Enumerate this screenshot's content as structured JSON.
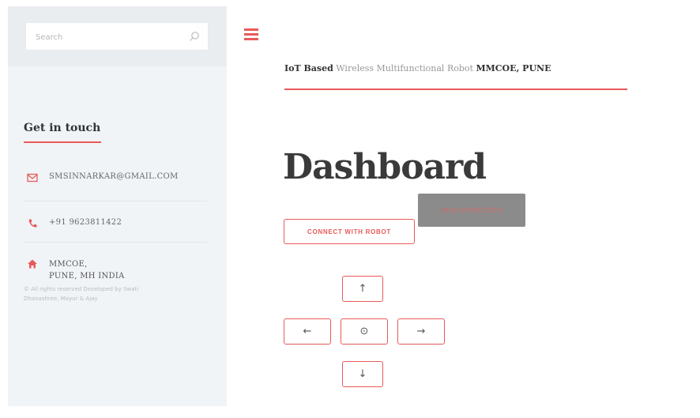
{
  "sidebar": {
    "search": {
      "placeholder": "Search"
    },
    "contact": {
      "title": "Get in touch",
      "email": "SMSINNARKAR@GMAIL.COM",
      "phone": "+91 9623811422",
      "address_line1": "MMCOE,",
      "address_line2": "PUNE, MH INDIA",
      "copyright_line1": "© All rights reserved Developed by Swati",
      "copyright_line2": "Dhanashree, Mayur & Ajay"
    }
  },
  "header": {
    "subtitle_bold1": "IoT Based",
    "subtitle_middle": " Wireless Multifunctional Robot ",
    "subtitle_bold2": "MMCOE, PUNE"
  },
  "main": {
    "title": "Dashboard",
    "connect_label": "CONNECT WITH ROBOT",
    "status_label": "DISCONNECTED",
    "controls": {
      "up": "↑",
      "left": "←",
      "stop": "⊙",
      "right": "→",
      "down": "↓"
    }
  },
  "colors": {
    "accent": "#e85a5a",
    "sidebar_bg": "#f1f4f7",
    "status_bg": "#8b8b8b"
  }
}
